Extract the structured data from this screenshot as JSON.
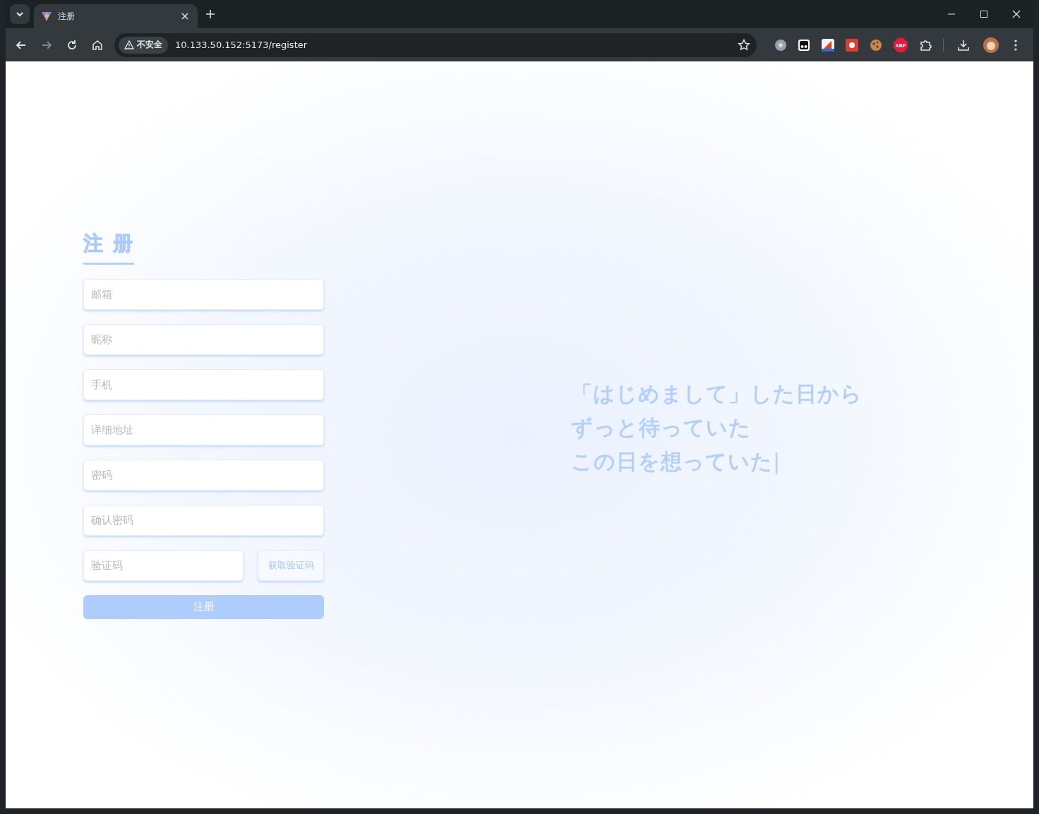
{
  "browser": {
    "tabs": [
      {
        "title": "注册",
        "selected": true
      }
    ],
    "address": {
      "security": "不安全",
      "url": "10.133.50.152:5173/register"
    },
    "nav": {
      "forward_enabled": false
    },
    "abp_label": "ABP"
  },
  "register": {
    "title": "注 册",
    "fields": [
      {
        "placeholder": "邮箱"
      },
      {
        "placeholder": "昵称"
      },
      {
        "placeholder": "手机"
      },
      {
        "placeholder": "详细地址"
      },
      {
        "placeholder": "密码"
      },
      {
        "placeholder": "确认密码"
      }
    ],
    "code": {
      "placeholder": "验证码",
      "button": "获取验证码"
    },
    "submit": "注册"
  },
  "typewriter": {
    "lines": [
      "「はじめまして」した日から",
      "ずっと待っていた",
      "この日を想っていた"
    ],
    "cursor": "|"
  }
}
